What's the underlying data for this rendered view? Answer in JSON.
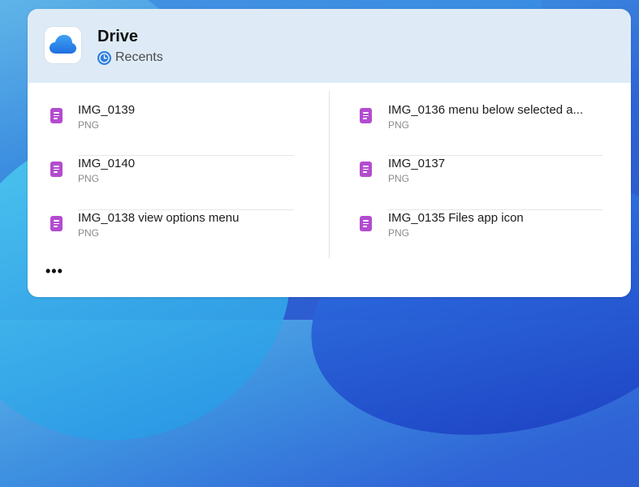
{
  "widget": {
    "app_title": "Drive",
    "subtitle": "Recents",
    "app_icon": "icloud-icon",
    "subtitle_icon": "clock-icon",
    "more_label": "•••"
  },
  "files": {
    "left": [
      {
        "name": "IMG_0139",
        "type": "PNG"
      },
      {
        "name": "IMG_0140",
        "type": "PNG"
      },
      {
        "name": "IMG_0138 view options menu",
        "type": "PNG"
      }
    ],
    "right": [
      {
        "name": "IMG_0136 menu below selected a...",
        "type": "PNG"
      },
      {
        "name": "IMG_0137",
        "type": "PNG"
      },
      {
        "name": "IMG_0135 Files app icon",
        "type": "PNG"
      }
    ]
  },
  "colors": {
    "header_bg": "#deebf7",
    "file_icon": "#b34ccf",
    "clock_icon": "#2f7fe0"
  }
}
